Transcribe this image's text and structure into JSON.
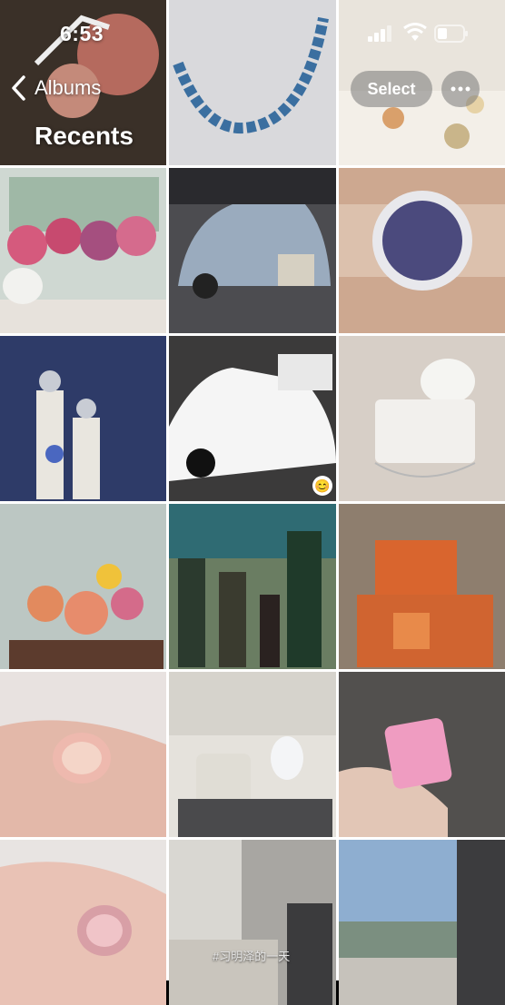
{
  "status_bar": {
    "time": "6:53"
  },
  "nav": {
    "back_label": "Albums",
    "title": "Recents",
    "select_label": "Select"
  },
  "photos": [
    {
      "subject": "jewelry"
    },
    {
      "subject": "necklace"
    },
    {
      "subject": "table"
    },
    {
      "subject": "flowers"
    },
    {
      "subject": "silver-car"
    },
    {
      "subject": "watch-wrist"
    },
    {
      "subject": "watch-display"
    },
    {
      "subject": "white-car"
    },
    {
      "subject": "handbag"
    },
    {
      "subject": "bouquet"
    },
    {
      "subject": "wine-bottles"
    },
    {
      "subject": "orange-boxes"
    },
    {
      "subject": "ring-hand"
    },
    {
      "subject": "jet-interior"
    },
    {
      "subject": "pink-ring"
    },
    {
      "subject": "ring-finger"
    },
    {
      "subject": "lounge"
    },
    {
      "subject": "city-view"
    }
  ],
  "watermark": "#习明泽的一天"
}
